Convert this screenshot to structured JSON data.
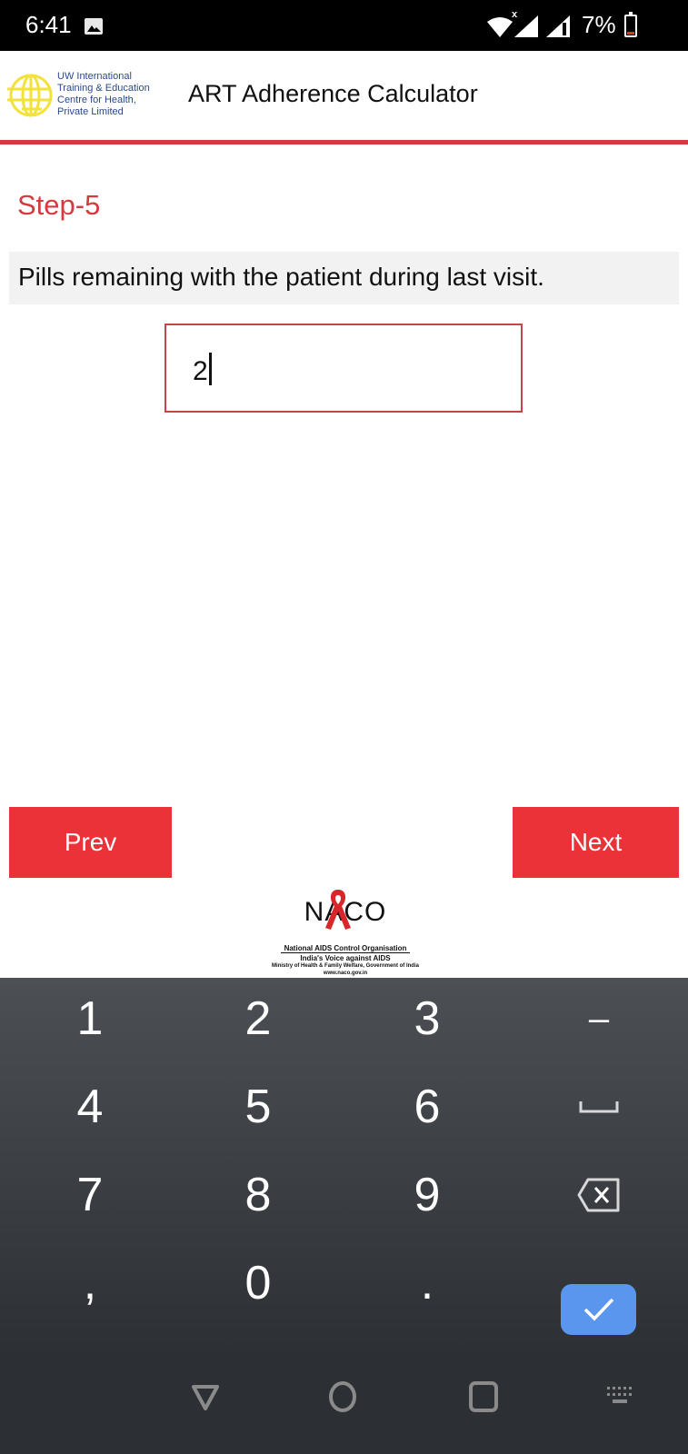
{
  "status_bar": {
    "time": "6:41",
    "notification_icon": "gallery-icon",
    "wifi_icon": "wifi-icon",
    "signal_label": "x",
    "signal_icons": [
      "signal-icon",
      "signal-icon"
    ],
    "battery_percent": "7%",
    "battery_icon": "battery-low-icon"
  },
  "header": {
    "logo_icon": "globe-icon",
    "org_name_lines": [
      "UW International",
      "Training & Education",
      "Centre for Health,",
      "Private Limited"
    ],
    "title": "ART Adherence Calculator",
    "accent_color": "#d8393e"
  },
  "main": {
    "step_title": "Step-5",
    "question": "Pills remaining with the patient during last visit.",
    "input": {
      "value": "2",
      "focused": true
    },
    "prev_label": "Prev",
    "next_label": "Next",
    "button_color": "#ec3239"
  },
  "footer_logo": {
    "ribbon_icon": "red-ribbon-icon",
    "wordmark": "NACO",
    "line1": "National AIDS Control Organisation",
    "line2": "India's Voice against AIDS",
    "line3": "Ministry of Health & Family Welfare, Government of India",
    "line4": "www.naco.gov.in"
  },
  "keyboard": {
    "rows": [
      [
        "1",
        "2",
        "3",
        "–"
      ],
      [
        "4",
        "5",
        "6",
        "space"
      ],
      [
        "7",
        "8",
        "9",
        "backspace"
      ],
      [
        ",",
        "0",
        ".",
        "enter"
      ]
    ],
    "enter_color": "#5b96ee"
  },
  "system_nav": {
    "back_icon": "back-triangle-icon",
    "home_icon": "home-circle-icon",
    "recents_icon": "recents-square-icon",
    "keyboard_switch_icon": "keyboard-icon"
  }
}
